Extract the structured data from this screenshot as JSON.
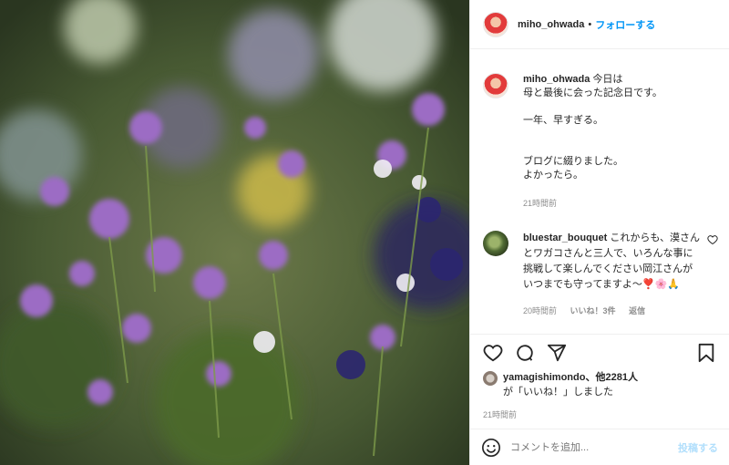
{
  "post": {
    "username": "miho_ohwada",
    "separator": "•",
    "follow_label": "フォローする"
  },
  "caption": {
    "username": "miho_ohwada",
    "line1": "今日は",
    "line2": "母と最後に会った記念日です。",
    "line3": "一年、早すぎる。",
    "line4": "ブログに綴りました。",
    "line5": "よかったら。",
    "time": "21時間前"
  },
  "comment": {
    "username": "bluestar_bouquet",
    "text": "これからも、漠さんとワガコさんと三人で、いろんな事に挑戦して楽しんでください岡江さんがいつまでも守ってますよ〜❣️🌸🙏",
    "time": "20時間前",
    "likes": "いいね！3件",
    "reply": "返信"
  },
  "likes_summary": {
    "user": "yamagishimondo",
    "others": "、他2281人",
    "suffix": "が「いいね！」しました"
  },
  "post_time": "21時間前",
  "composer": {
    "placeholder": "コメントを追加...",
    "post_label": "投稿する"
  },
  "icons": [
    "heart-icon",
    "comment-icon",
    "share-icon",
    "bookmark-icon",
    "emoji-icon"
  ],
  "colors": {
    "accent": "#0095f6",
    "muted": "#8e8e8e",
    "text": "#262626"
  }
}
